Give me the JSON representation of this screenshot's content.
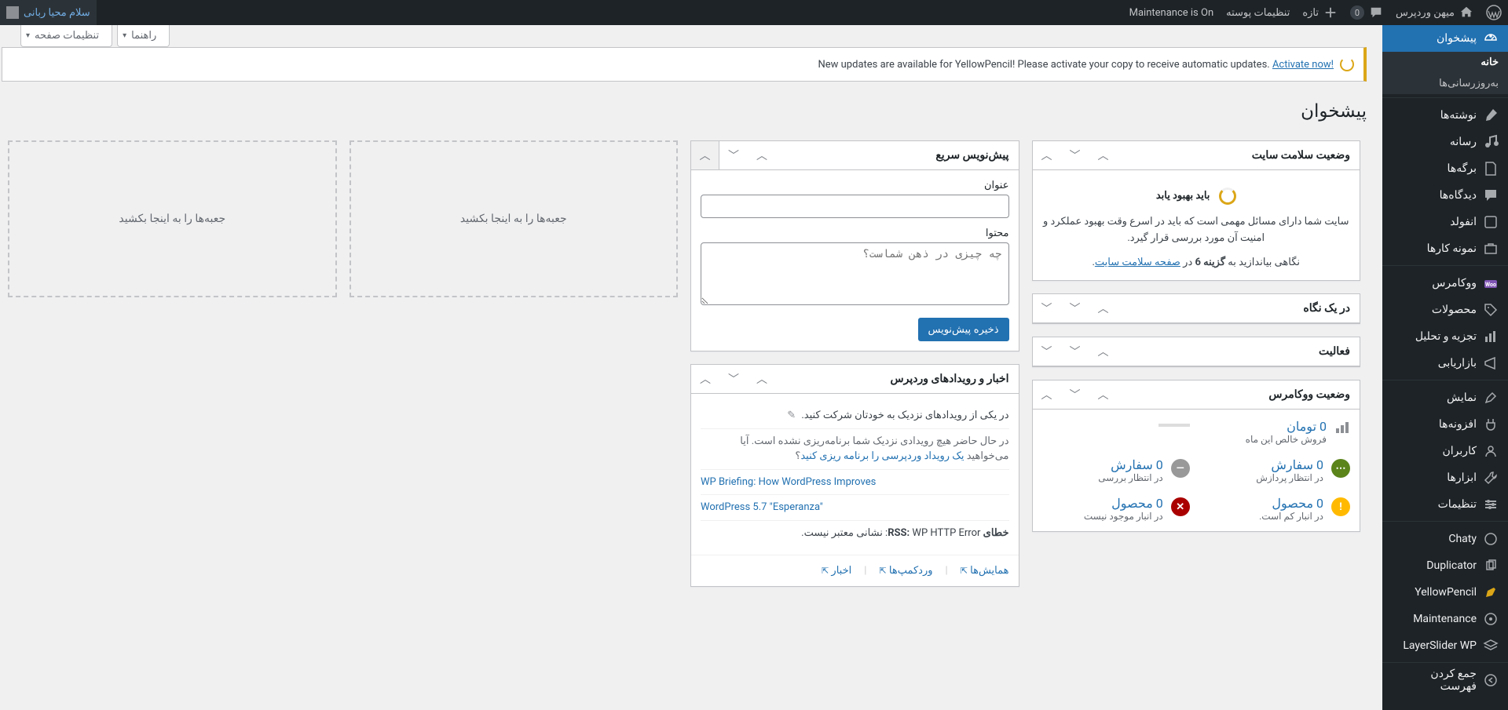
{
  "adminbar": {
    "site_title": "میهن وردپرس",
    "comments": "0",
    "new": "تازه",
    "theme_settings": "تنظیمات پوسته",
    "maintenance": "Maintenance is On",
    "greeting": "سلام محیا ربانی"
  },
  "menu": {
    "dashboard": "پیشخوان",
    "home": "خانه",
    "updates": "به‌روزرسانی‌ها",
    "posts": "نوشته‌ها",
    "media": "رسانه",
    "pages": "برگه‌ها",
    "comments": "دیدگاه‌ها",
    "enfold": "انفولد",
    "portfolio": "نمونه کارها",
    "woocommerce": "ووکامرس",
    "products": "محصولات",
    "analytics": "تجزیه و تحلیل",
    "marketing": "بازاریابی",
    "appearance": "نمایش",
    "plugins": "افزونه‌ها",
    "users": "کاربران",
    "tools": "ابزارها",
    "settings": "تنظیمات",
    "chaty": "Chaty",
    "duplicator": "Duplicator",
    "yellowpencil": "YellowPencil",
    "maintenance": "Maintenance",
    "layerslider": "LayerSlider WP",
    "collapse": "جمع کردن فهرست"
  },
  "screen_meta": {
    "options": "تنظیمات صفحه",
    "help": "راهنما"
  },
  "notice": {
    "text": "New updates are available for YellowPencil! Please activate your copy to receive automatic updates. ",
    "link": "Activate now!"
  },
  "page_title": "پیشخوان",
  "widgets": {
    "site_health": {
      "title": "وضعیت سلامت سایت",
      "status": "باید بهبود یابد",
      "desc": "سایت شما دارای مسائل مهمی است که باید در اسرع وقت بهبود عملکرد و امنیت آن مورد بررسی قرار گیرد.",
      "link_pre": "نگاهی بیاندازید به ",
      "link_count": "گزینه 6",
      "link_mid": " در ",
      "link_page": "صفحه سلامت سایت"
    },
    "glance": {
      "title": "در یک نگاه"
    },
    "activity": {
      "title": "فعالیت"
    },
    "wc_status": {
      "title": "وضعیت ووکامرس",
      "net_sales": "0 تومان",
      "net_sales_sub": "فروش خالص این ماه",
      "orders_proc": "0 سفارش",
      "orders_proc_sub": "در انتظار پردازش",
      "orders_hold": "0 سفارش",
      "orders_hold_sub": "در انتظار بررسی",
      "low_stock": "0 محصول",
      "low_stock_sub": "در انبار کم است.",
      "out_stock": "0 محصول",
      "out_stock_sub": "در انبار موجود نیست"
    },
    "quick_draft": {
      "title": "پیش‌نویس سریع",
      "title_label": "عنوان",
      "content_label": "محتوا",
      "placeholder": "چه چیزی در ذهن شماست؟",
      "save": "ذخیره پیش‌نویس"
    },
    "news": {
      "title": "اخبار و رویدادهای وردپرس",
      "attend": "در یکی از رویدادهای نزدیک به خودتان شرکت کنید.",
      "no_events_pre": "در حال حاضر هیچ رویدادی نزدیک شما برنامه‌ریزی نشده است. آیا می‌خواهید ",
      "no_events_link": "یک رویداد وردپرسی را برنامه ریزی کنید",
      "no_events_post": "؟",
      "item1": "WP Briefing: How WordPress Improves",
      "item2": "WordPress 5.7 \"Esperanza\"",
      "rss_error_pre": "خطای RSS:",
      "rss_error": " WP HTTP Error: نشانی معتبر نیست.",
      "meetups": "همایش‌ها",
      "wordcamps": "وردکمپ‌ها",
      "news_link": "اخبار"
    },
    "drop_placeholder": "جعبه‌ها را به اینجا بکشید"
  }
}
